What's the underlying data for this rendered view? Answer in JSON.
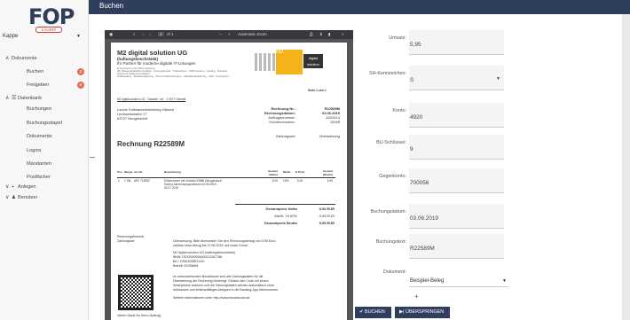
{
  "header": {
    "title": "Buchen"
  },
  "sidebar": {
    "logo": {
      "text": "FOP",
      "sub": "LAUNIX"
    },
    "client": "Kappe",
    "section": "Dokumente",
    "items": [
      {
        "label": "Buchen",
        "badge": "2"
      },
      {
        "label": "Freigeben",
        "badge": "9"
      }
    ],
    "group": "Datenbank",
    "subitems": [
      "Buchungen",
      "Buchungsstapel",
      "Dokumente",
      "Logins",
      "Mandanten",
      "Postfächer"
    ],
    "anlegen": "Anlegen",
    "benutzer": "Benutzer"
  },
  "pdf": {
    "page": "1",
    "of": "of 1",
    "zoom": "Automatic Zoom",
    "company": "M2 digital solution UG",
    "company_sub": "(haftungsbeschränkt)",
    "slogan": "Ihr Partner für moderne digitale IT-Lösungen",
    "line1": "E-Commerce und Online Systeme",
    "line2": "3D, Wissenschaftliche Grafiken · Lösungsmodell · Onlineshops · CMS Systeme · Hosting · Domains",
    "line3": "Internet & Telekommunikation",
    "line4": "Tarifberatung · Breitbandplanung · VM und Datenlösungen · Glasfaserabdeckung · VoIP · Kommunen",
    "logo_text": "M2",
    "logo_sub1": "digital",
    "logo_sub2": "solution",
    "page_of": "Seite 1 von 1",
    "sender": "M2 digital solution UG · Ostwald · str. · 2 0377 Ostedal",
    "recipient": [
      "Launix Softwareentwicklung Hänsch",
      "Lindhorststraße 17",
      "63727 Neugersdorf"
    ],
    "meta": [
      {
        "k": "Rechnung-Nr.:",
        "v": "R22589M"
      },
      {
        "k": "Rechnungsdatum:",
        "v": "03.06.2019"
      },
      {
        "k": "Auftragsnummer:",
        "v": "A226114"
      },
      {
        "k": "Kundennummer:",
        "v": "10045"
      }
    ],
    "payment_k": "Zahlungsart:",
    "payment_v": "Überweisung",
    "title": "Rechnung R22589M",
    "cols": [
      "Pos.",
      "Menge",
      "Art.-Nr.",
      "Bezeichnung",
      "Gesamt (Netto)",
      "MwSt.",
      "E-Preis",
      "Gesamt (Brutto)"
    ],
    "row": {
      "pos": "1",
      "menge": "1 Stk.",
      "art": "ART 715092",
      "desc1": "Kühlnummer mit Vorwahl 03586 (Neugersdorf",
      "desc2": "Sachs) Abrechnungszeitraum 04.06.2019 -",
      "desc3": "04.07.2019",
      "netto": "5,00",
      "mwst": "19%",
      "epreis": "5,00",
      "brutto": "5,95"
    },
    "totals": [
      {
        "k": "Gesamtpreis Netto",
        "v": "5,00 EUR"
      },
      {
        "k": "MwSt. 19,00%",
        "v": "0,95 EUR"
      },
      {
        "k": "Gesamtpreis Brutto",
        "v": "5,95 EUR"
      }
    ],
    "hint_k": "Rechnungshinweis",
    "hint_sub": "Zahlungsart:",
    "hint1": "Überweisung: Bitte überweisen Sie den Rechnungsbetrag von 5,95 Euro,",
    "hint2": "zahlbar ohne Abzug bis 17.06.2019, auf unser Konto:",
    "bank1": "M2 digital solution UG (haftungsbeschränkt)",
    "bank2": "IBAN: DE33000900000221167788",
    "bank3": "BIC: DSKDDEBI1XXX",
    "bank4": "Betreff: R22589M",
    "qr1": "Im nebenstehenden Bezahlcode sind alle Zahlungsdaten für die",
    "qr2": "Überweisung der Rechnung hinterlegt. Einfach den Code mit einem",
    "qr3": "Smartphone scannen und die Zahlungsdaten werden automatisch ohne",
    "qr4": "mühsames und fehleranfälliges Abtippen in die Banking-App übernommen.",
    "qr5": "Weitere Informationen unter http://www.bezahlcode.de.",
    "thanks": "Vielen Dank für Ihren Auftrag."
  },
  "form": {
    "fields": [
      {
        "label": "Umsatz:",
        "value": "5,95"
      },
      {
        "label": "SH-Kennzeichen:",
        "value": "S",
        "dropdown": true
      },
      {
        "label": "Konto:",
        "value": "4920"
      },
      {
        "label": "BU-Schlüssel:",
        "value": "9"
      },
      {
        "label": "Gegenkonto:",
        "value": "700056"
      },
      {
        "label": "Buchungsdatum:",
        "value": "03.06.2019"
      },
      {
        "label": "Buchungstext:",
        "value": "R22589M"
      }
    ],
    "doc_label": "Dokument:",
    "doc_value": "Beispiel-Beleg",
    "plus": "+",
    "btn_buchen": "BUCHEN",
    "btn_skip": "ÜBERSPRINGEN"
  }
}
